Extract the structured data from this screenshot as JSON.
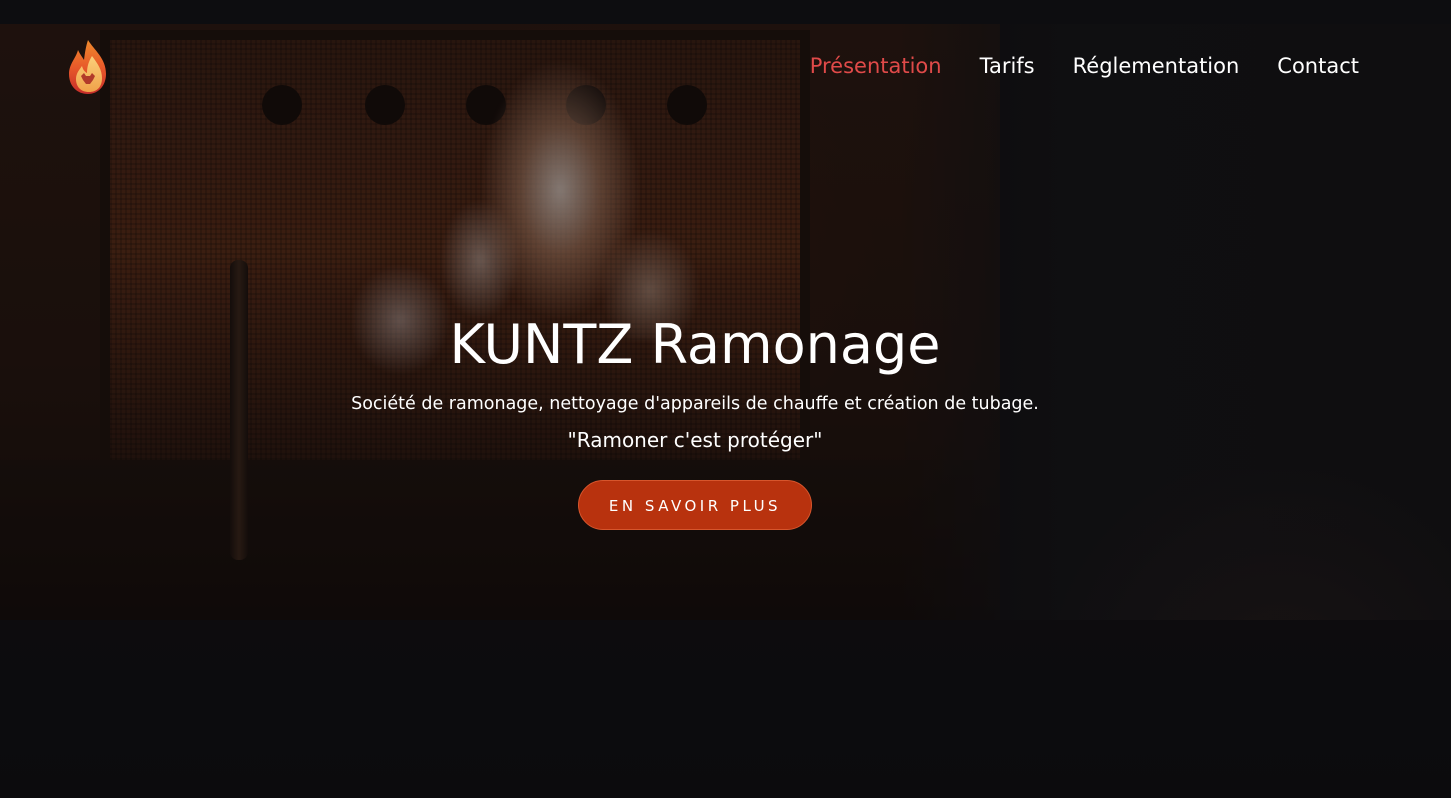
{
  "header": {
    "logo_icon": "flame-logo-icon",
    "nav": [
      {
        "label": "Présentation",
        "active": true
      },
      {
        "label": "Tarifs",
        "active": false
      },
      {
        "label": "Réglementation",
        "active": false
      },
      {
        "label": "Contact",
        "active": false
      }
    ]
  },
  "hero": {
    "title": "KUNTZ Ramonage",
    "subtitle": "Société de ramonage, nettoyage d'appareils de chauffe et création de tubage.",
    "quote": "\"Ramoner c'est protéger\"",
    "cta_label": "EN SAVOIR PLUS"
  },
  "colors": {
    "nav_active": "#e04a49",
    "cta_background": "#b8320e",
    "text": "#ffffff"
  }
}
